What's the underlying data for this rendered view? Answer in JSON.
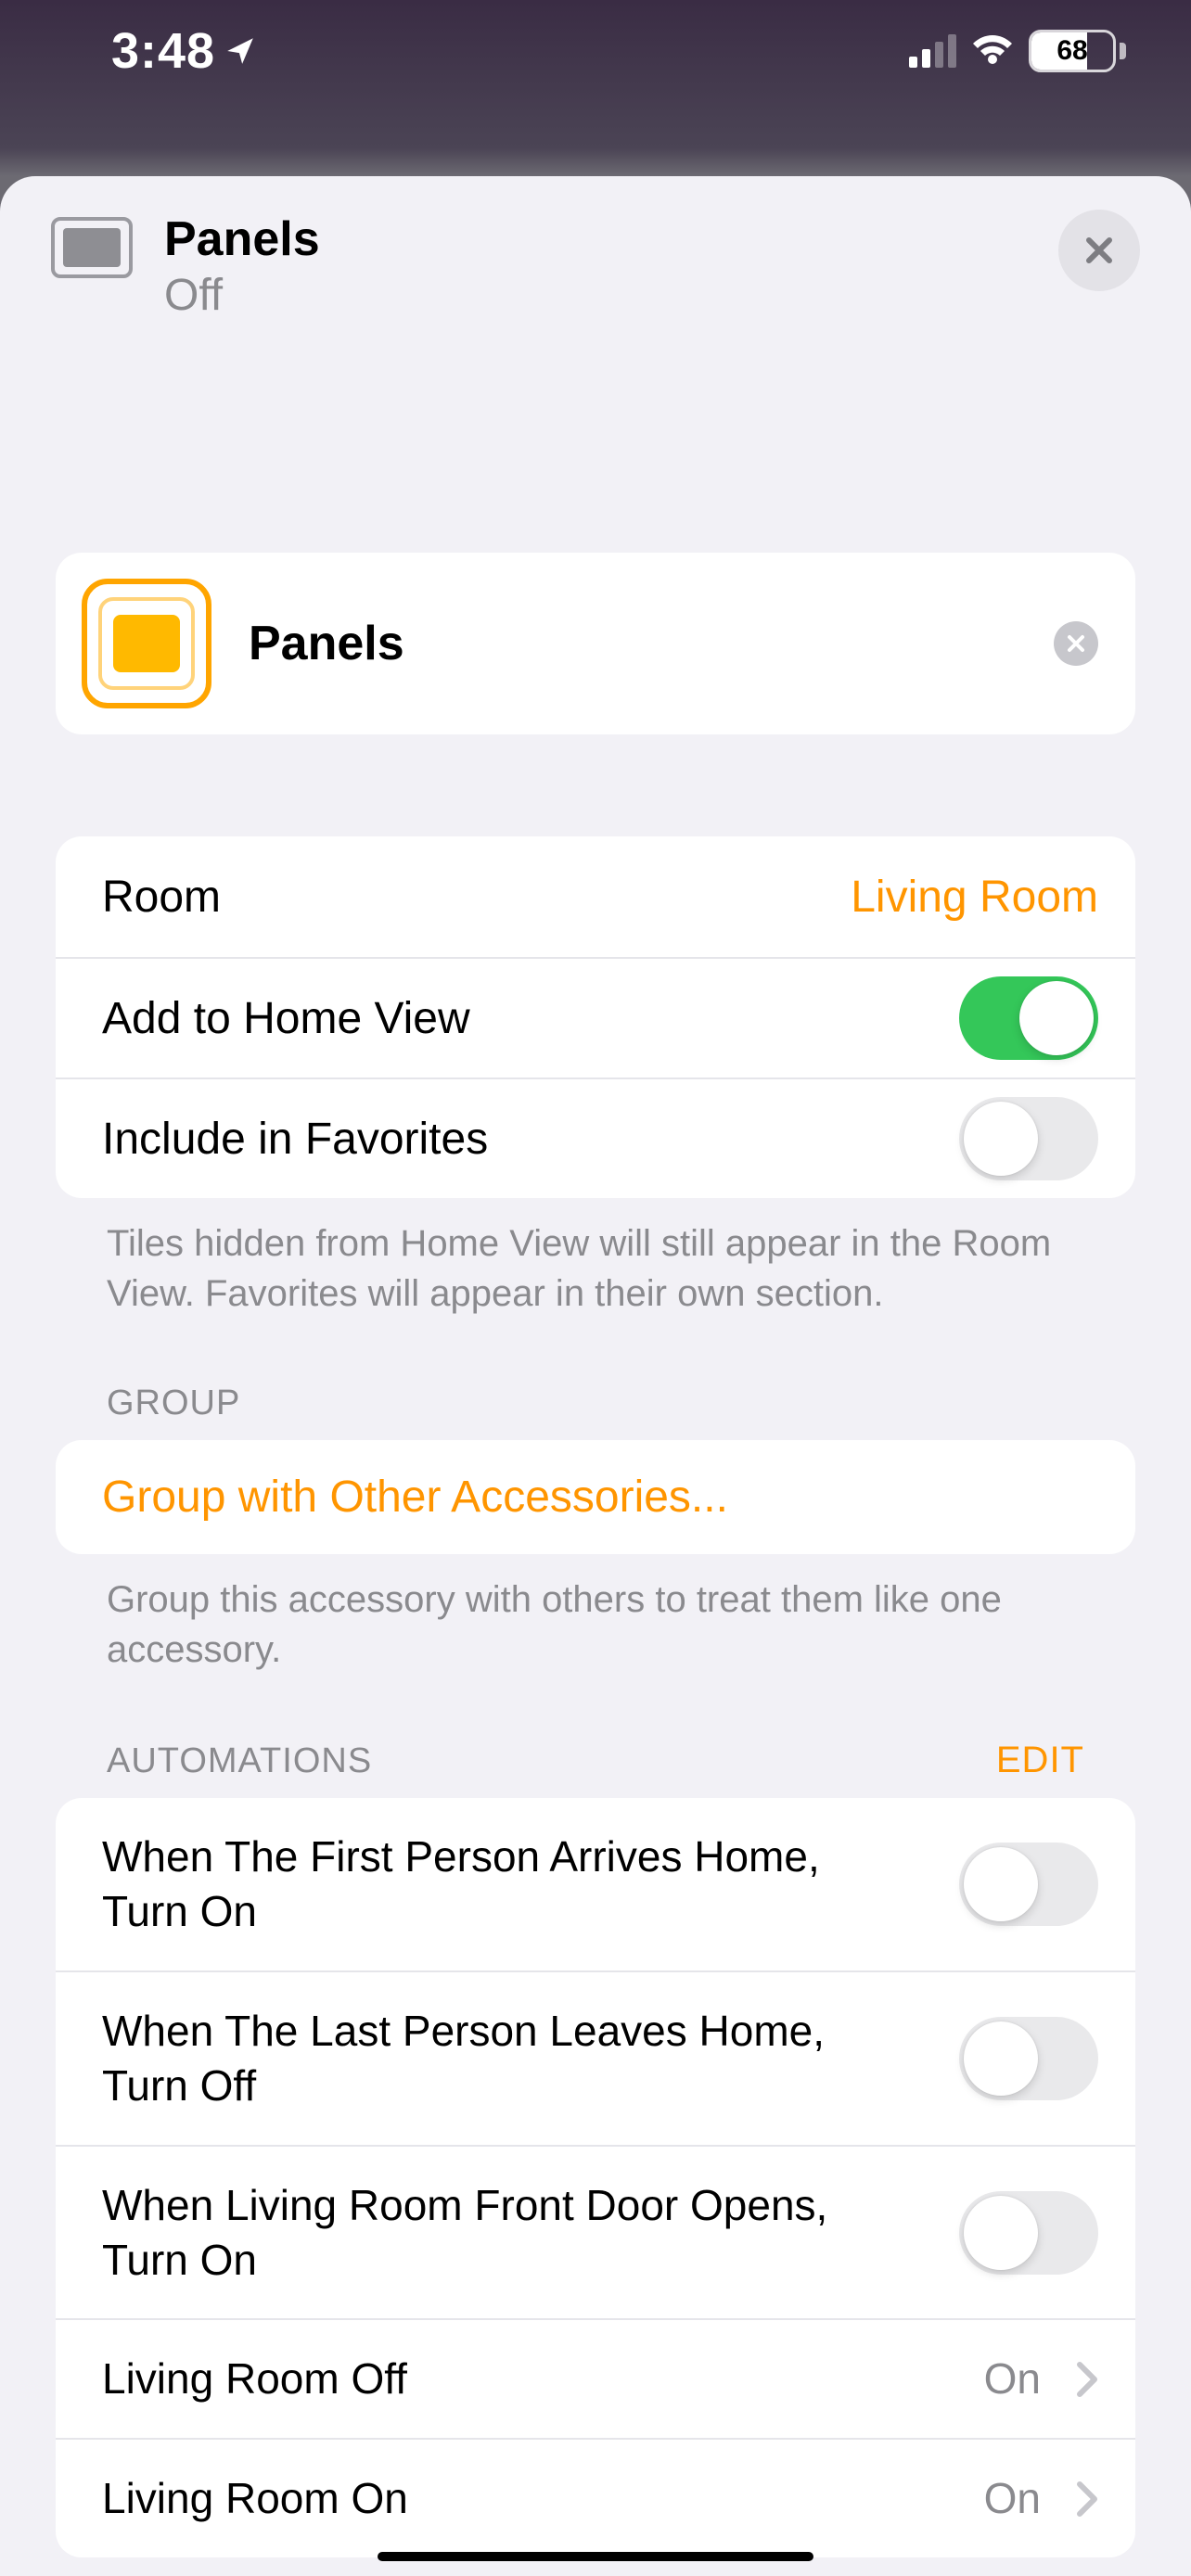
{
  "status": {
    "time": "3:48",
    "battery": "68"
  },
  "header": {
    "title": "Panels",
    "subtitle": "Off"
  },
  "name_card": {
    "value": "Panels"
  },
  "settings": {
    "room_label": "Room",
    "room_value": "Living Room",
    "home_view_label": "Add to Home View",
    "favorites_label": "Include in Favorites",
    "footer": "Tiles hidden from Home View will still appear in the Room View. Favorites will appear in their own section."
  },
  "group_section": {
    "title": "GROUP",
    "link": "Group with Other Accessories...",
    "footer": "Group this accessory with others to treat them like one accessory."
  },
  "automations_section": {
    "title": "AUTOMATIONS",
    "edit": "EDIT",
    "items": [
      {
        "text": "When The First Person Arrives Home, Turn On",
        "type": "toggle",
        "on": false
      },
      {
        "text": "When The Last Person Leaves Home, Turn Off",
        "type": "toggle",
        "on": false
      },
      {
        "text": "When Living Room Front Door Opens, Turn On",
        "type": "toggle",
        "on": false
      },
      {
        "text": "Living Room Off",
        "type": "link",
        "status": "On"
      },
      {
        "text": "Living Room On",
        "type": "link",
        "status": "On"
      }
    ]
  }
}
